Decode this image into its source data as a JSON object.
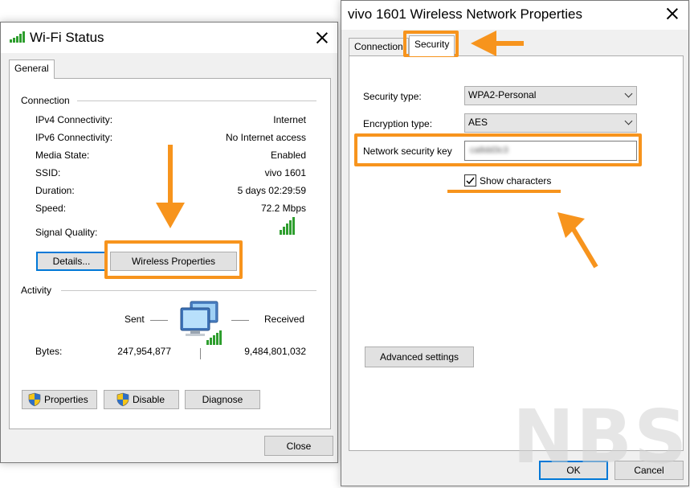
{
  "wifi_status": {
    "title": "Wi-Fi Status",
    "tab": "General",
    "connection_header": "Connection",
    "rows": [
      {
        "label": "IPv4 Connectivity:",
        "value": "Internet"
      },
      {
        "label": "IPv6 Connectivity:",
        "value": "No Internet access"
      },
      {
        "label": "Media State:",
        "value": "Enabled"
      },
      {
        "label": "SSID:",
        "value": "vivo 1601"
      },
      {
        "label": "Duration:",
        "value": "5 days 02:29:59"
      },
      {
        "label": "Speed:",
        "value": "72.2 Mbps"
      }
    ],
    "signal_label": "Signal Quality:",
    "signal_bars_filled": 5,
    "details_button": "Details...",
    "wireless_properties_button": "Wireless Properties",
    "activity_header": "Activity",
    "sent_label": "Sent",
    "received_label": "Received",
    "bytes_label": "Bytes:",
    "bytes_sent": "247,954,877",
    "bytes_received": "9,484,801,032",
    "properties_button": "Properties",
    "disable_button": "Disable",
    "diagnose_button": "Diagnose",
    "close_button": "Close"
  },
  "network_properties": {
    "title": "vivo 1601 Wireless Network Properties",
    "tabs": [
      "Connection",
      "Security"
    ],
    "active_tab": "Security",
    "security_type_label": "Security type:",
    "security_type_value": "WPA2-Personal",
    "encryption_type_label": "Encryption type:",
    "encryption_type_value": "AES",
    "network_key_label": "Network security key",
    "network_key_value": "ca8dd3c3",
    "show_characters_label": "Show characters",
    "show_characters_checked": true,
    "advanced_settings_button": "Advanced settings",
    "ok_button": "OK",
    "cancel_button": "Cancel"
  },
  "watermark": "NBS",
  "colors": {
    "highlight": "#f7941d",
    "signal_green": "#2e9e2e",
    "focus_blue": "#0078d7",
    "dialog_bg": "#f0f0f0"
  }
}
